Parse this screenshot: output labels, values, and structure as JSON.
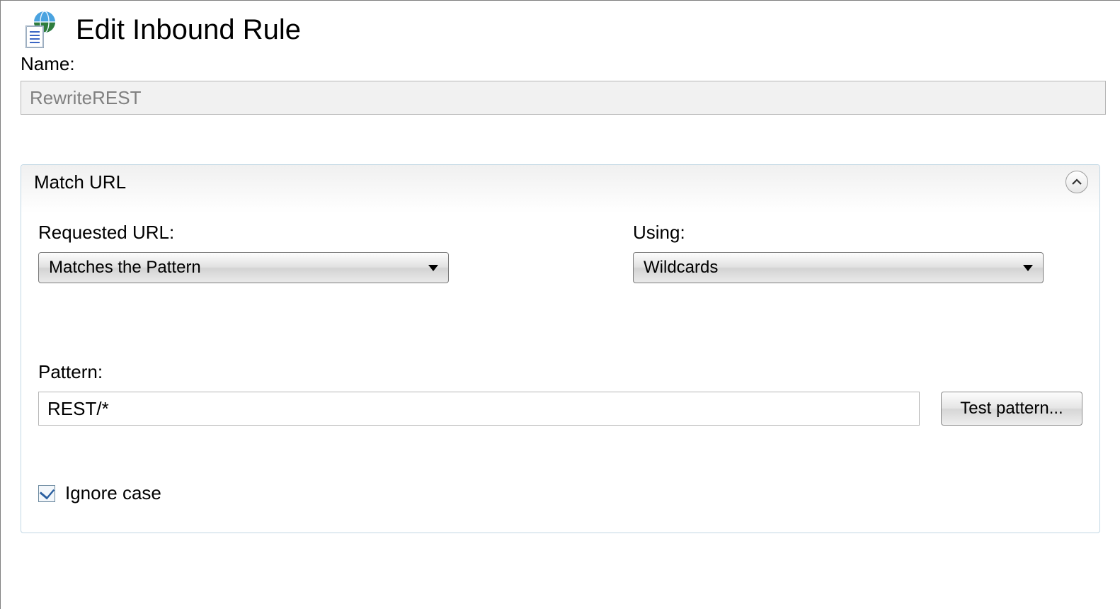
{
  "header": {
    "title": "Edit Inbound Rule"
  },
  "name_field": {
    "label": "Name:",
    "value": "RewriteREST"
  },
  "match_url_panel": {
    "title": "Match URL",
    "requested_url": {
      "label": "Requested URL:",
      "selected": "Matches the Pattern"
    },
    "using": {
      "label": "Using:",
      "selected": "Wildcards"
    },
    "pattern": {
      "label": "Pattern:",
      "value": "REST/*",
      "test_button": "Test pattern..."
    },
    "ignore_case": {
      "label": "Ignore case",
      "checked": true
    }
  }
}
